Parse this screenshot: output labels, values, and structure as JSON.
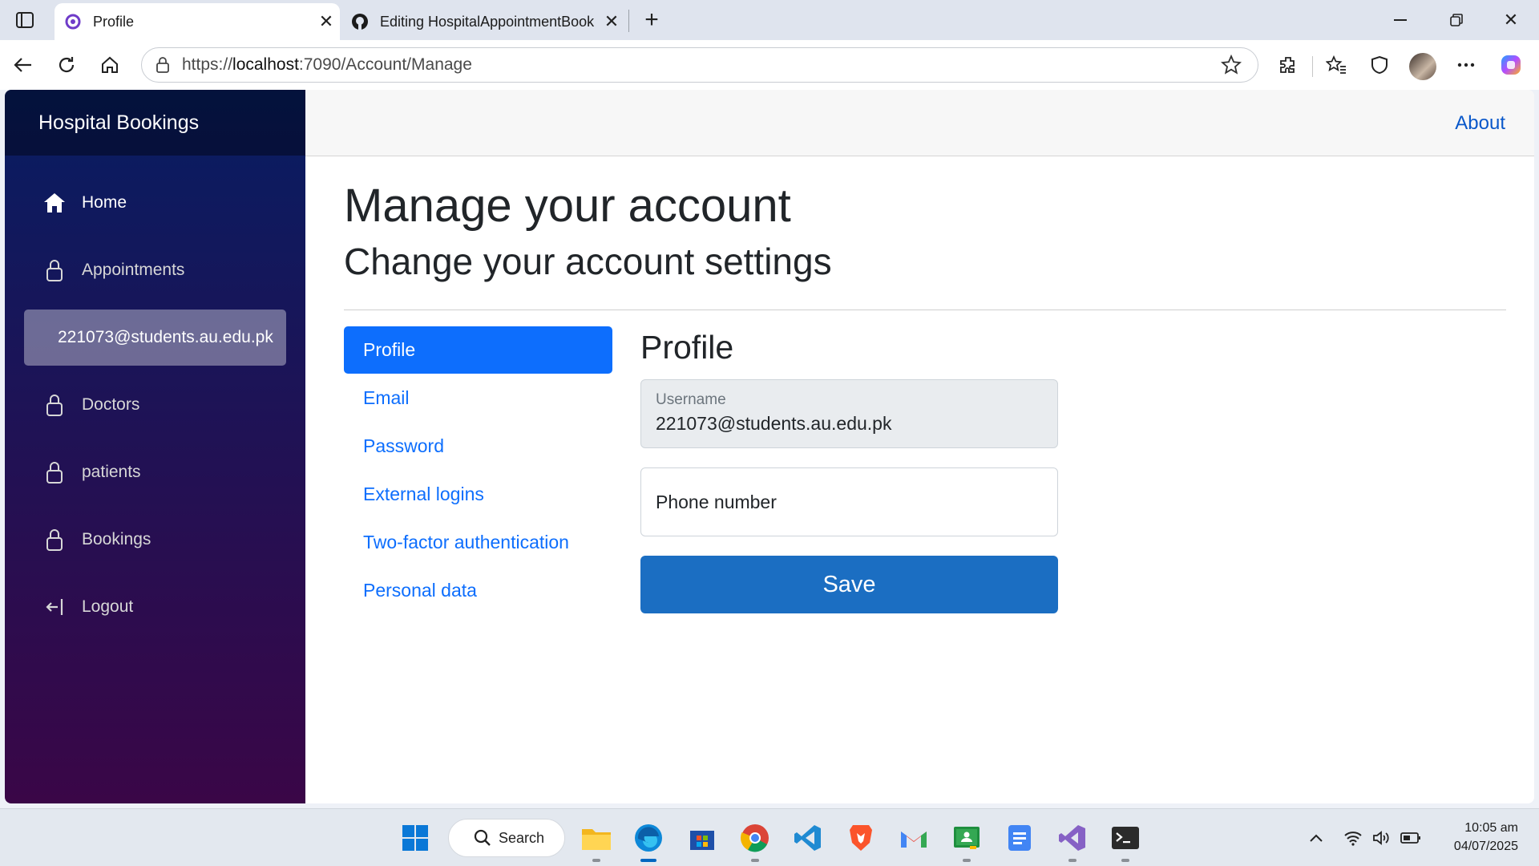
{
  "browser": {
    "tabs": [
      {
        "title": "Profile",
        "active": true
      },
      {
        "title": "Editing HospitalAppointmentBook",
        "active": false
      }
    ],
    "url_prefix": "https://",
    "url_host": "localhost",
    "url_path": ":7090/Account/Manage"
  },
  "app": {
    "brand": "Hospital Bookings",
    "top_link": "About"
  },
  "sidebar": {
    "items": [
      {
        "label": "Home",
        "icon": "home-icon"
      },
      {
        "label": "Appointments",
        "icon": "lock-icon"
      },
      {
        "label": "221073@students.au.edu.pk",
        "icon": "none"
      },
      {
        "label": "Doctors",
        "icon": "lock-icon"
      },
      {
        "label": "patients",
        "icon": "lock-icon"
      },
      {
        "label": "Bookings",
        "icon": "lock-icon"
      },
      {
        "label": "Logout",
        "icon": "logout-icon"
      }
    ]
  },
  "main": {
    "title": "Manage your account",
    "subtitle": "Change your account settings",
    "manage_nav": [
      {
        "label": "Profile",
        "active": true
      },
      {
        "label": "Email"
      },
      {
        "label": "Password"
      },
      {
        "label": "External logins"
      },
      {
        "label": "Two-factor authentication"
      },
      {
        "label": "Personal data"
      }
    ],
    "section_title": "Profile",
    "username_label": "Username",
    "username_value": "221073@students.au.edu.pk",
    "phone_label": "Phone number",
    "save_label": "Save"
  },
  "taskbar": {
    "search_label": "Search",
    "time": "10:05 am",
    "date": "04/07/2025"
  },
  "colors": {
    "accent": "#0d6efd",
    "save_button": "#1b6ec2",
    "sidebar_top": "#071d62",
    "sidebar_bottom": "#3a0647"
  }
}
